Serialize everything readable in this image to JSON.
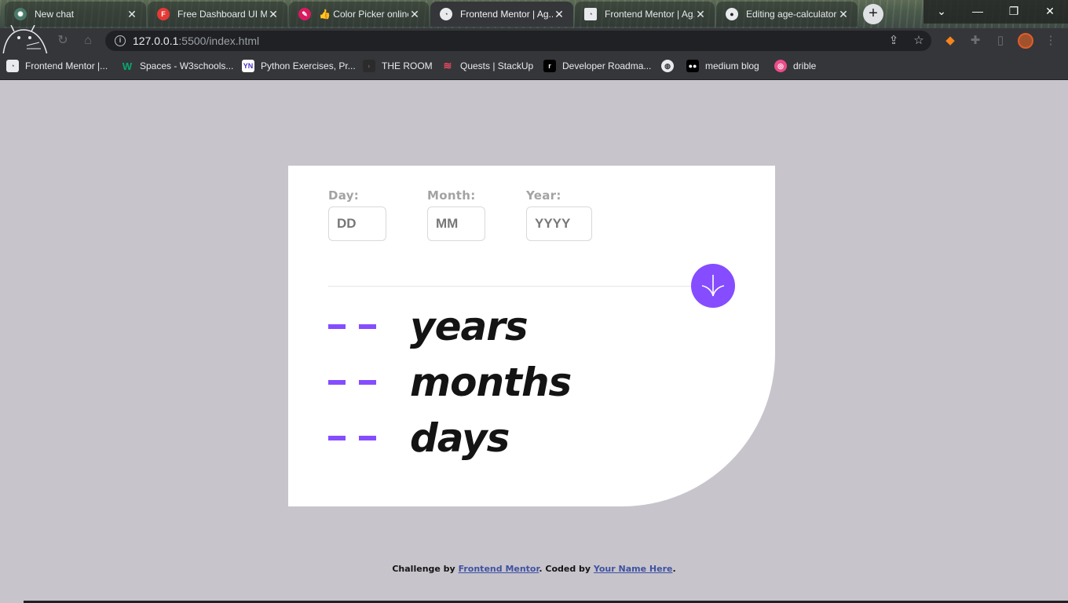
{
  "browser": {
    "tabs": [
      {
        "title": "New chat",
        "icon": "openai-icon",
        "color": "#4a7a6a"
      },
      {
        "title": "Free Dashboard UI M...",
        "icon": "fft-icon",
        "color": "#e53935"
      },
      {
        "title": "👍 Color Picker online",
        "icon": "color-picker-icon",
        "color": "#d81b60"
      },
      {
        "title": "Frontend Mentor | Ag...",
        "icon": "frontend-mentor-icon",
        "color": "#e8eaed"
      },
      {
        "title": "Frontend Mentor | Ag...",
        "icon": "frontend-mentor-icon",
        "color": "#e8eaed"
      },
      {
        "title": "Editing age-calculator",
        "icon": "github-icon",
        "color": "#e8eaed"
      }
    ],
    "url_host": "127.0.0.1",
    "url_path": ":5500/index.html",
    "bookmarks": [
      {
        "label": "Frontend Mentor |...",
        "icon": "frontend-mentor-icon"
      },
      {
        "label": "Spaces - W3schools...",
        "icon": "w3schools-icon"
      },
      {
        "label": "Python Exercises, Pr...",
        "icon": "python-exercises-icon"
      },
      {
        "label": "THE ROOM",
        "icon": "the-room-icon"
      },
      {
        "label": "Quests | StackUp",
        "icon": "stackup-icon"
      },
      {
        "label": "Developer Roadma...",
        "icon": "roadmap-icon"
      },
      {
        "label": "",
        "icon": "globe-icon"
      },
      {
        "label": "medium blog",
        "icon": "medium-icon"
      },
      {
        "label": "drible",
        "icon": "dribbble-icon"
      }
    ]
  },
  "form": {
    "day": {
      "label": "Day:",
      "placeholder": "DD"
    },
    "month": {
      "label": "Month:",
      "placeholder": "MM"
    },
    "year": {
      "label": "Year:",
      "placeholder": "YYYY"
    },
    "submit_icon": "arrow-down-icon"
  },
  "results": [
    {
      "value": "- -",
      "unit": "years"
    },
    {
      "value": "- -",
      "unit": "months"
    },
    {
      "value": "- -",
      "unit": "days"
    }
  ],
  "attribution": {
    "prefix": "Challenge by ",
    "challenge_link": "Frontend Mentor",
    "middle": ". Coded by ",
    "author_link": "Your Name Here",
    "suffix": "."
  },
  "colors": {
    "accent": "#854dff",
    "background": "#c8c4cb",
    "card": "#ffffff"
  }
}
